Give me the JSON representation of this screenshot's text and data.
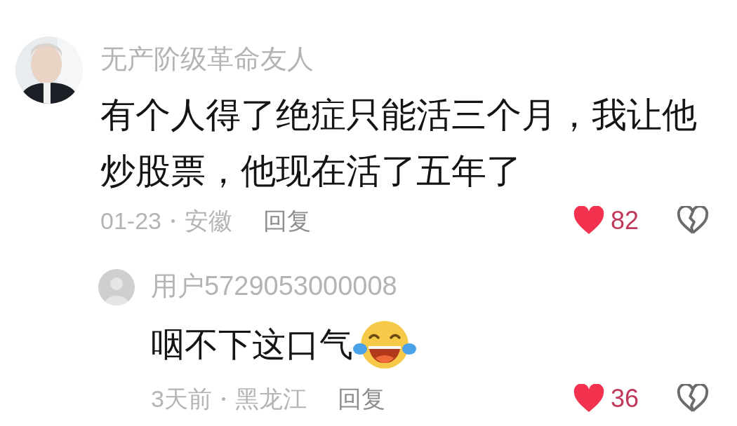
{
  "comments": [
    {
      "author": "无产阶级革命友人",
      "text": "有个人得了绝症只能活三个月，我让他炒股票，他现在活了五年了",
      "date": "01-23",
      "location": "安徽",
      "reply_label": "回复",
      "likes": "82",
      "liked": true,
      "children": [
        {
          "author": "用户5729053000008",
          "avatar": {
            "kind": "placeholder"
          },
          "text": "咽不下这口气",
          "emoji": {
            "kind": "laughing-crying"
          },
          "date": "3天前",
          "location": "黑龙江",
          "reply_label": "回复",
          "likes": "36",
          "liked": true
        }
      ]
    }
  ]
}
